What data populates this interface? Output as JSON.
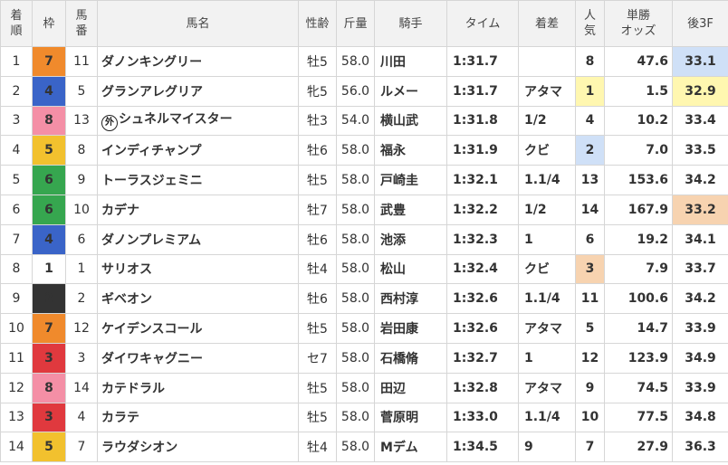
{
  "headers": {
    "rank": [
      "着",
      "順"
    ],
    "waku": "枠",
    "umaban": [
      "馬",
      "番"
    ],
    "horse": "馬名",
    "sex_age": "性齢",
    "weight": "斤量",
    "jockey": "騎手",
    "time": "タイム",
    "margin": "着差",
    "popularity": [
      "人",
      "気"
    ],
    "odds": [
      "単勝",
      "オッズ"
    ],
    "last3f": "後3F"
  },
  "waku_colors": {
    "1": "#ffffff",
    "2": "#333333",
    "3": "#e0393e",
    "4": "#3a64c8",
    "5": "#f2c12e",
    "6": "#36a64f",
    "7": "#f08a2c",
    "8": "#f48fa6"
  },
  "highlight_colors": {
    "pop1": "#fff7b0",
    "pop2": "#cfe0f7",
    "pop3": "#f7d3b0",
    "l3f1": "#cfe0f7",
    "l3f2": "#fff7b0",
    "l3f3": "#f7d3b0"
  },
  "rows": [
    {
      "rank": "1",
      "waku": "7",
      "umaban": "11",
      "horse": "ダノンキングリー",
      "foreign": false,
      "sex_age": "牡5",
      "weight": "58.0",
      "jockey": "川田",
      "time": "1:31.7",
      "margin": "",
      "popularity": "8",
      "odds": "47.6",
      "last3f": "33.1",
      "odds_red": false,
      "pop_hl": "",
      "l3f_hl": "l3f1"
    },
    {
      "rank": "2",
      "waku": "4",
      "umaban": "5",
      "horse": "グランアレグリア",
      "foreign": false,
      "sex_age": "牝5",
      "weight": "56.0",
      "jockey": "ルメー",
      "time": "1:31.7",
      "margin": "アタマ",
      "popularity": "1",
      "odds": "1.5",
      "last3f": "32.9",
      "odds_red": true,
      "pop_hl": "pop1",
      "l3f_hl": "l3f2"
    },
    {
      "rank": "3",
      "waku": "8",
      "umaban": "13",
      "horse": "シュネルマイスター",
      "foreign": true,
      "foreign_mark": "外",
      "sex_age": "牡3",
      "weight": "54.0",
      "jockey": "横山武",
      "time": "1:31.8",
      "margin": "1/2",
      "popularity": "4",
      "odds": "10.2",
      "last3f": "33.4",
      "odds_red": false,
      "pop_hl": "",
      "l3f_hl": ""
    },
    {
      "rank": "4",
      "waku": "5",
      "umaban": "8",
      "horse": "インディチャンプ",
      "foreign": false,
      "sex_age": "牡6",
      "weight": "58.0",
      "jockey": "福永",
      "time": "1:31.9",
      "margin": "クビ",
      "popularity": "2",
      "odds": "7.0",
      "last3f": "33.5",
      "odds_red": true,
      "pop_hl": "pop2",
      "l3f_hl": ""
    },
    {
      "rank": "5",
      "waku": "6",
      "umaban": "9",
      "horse": "トーラスジェミニ",
      "foreign": false,
      "sex_age": "牡5",
      "weight": "58.0",
      "jockey": "戸崎圭",
      "time": "1:32.1",
      "margin": "1.1/4",
      "popularity": "13",
      "odds": "153.6",
      "last3f": "34.2",
      "odds_red": false,
      "pop_hl": "",
      "l3f_hl": ""
    },
    {
      "rank": "6",
      "waku": "6",
      "umaban": "10",
      "horse": "カデナ",
      "foreign": false,
      "sex_age": "牡7",
      "weight": "58.0",
      "jockey": "武豊",
      "time": "1:32.2",
      "margin": "1/2",
      "popularity": "14",
      "odds": "167.9",
      "last3f": "33.2",
      "odds_red": false,
      "pop_hl": "",
      "l3f_hl": "l3f3"
    },
    {
      "rank": "7",
      "waku": "4",
      "umaban": "6",
      "horse": "ダノンプレミアム",
      "foreign": false,
      "sex_age": "牡6",
      "weight": "58.0",
      "jockey": "池添",
      "time": "1:32.3",
      "margin": "1",
      "popularity": "6",
      "odds": "19.2",
      "last3f": "34.1",
      "odds_red": false,
      "pop_hl": "",
      "l3f_hl": ""
    },
    {
      "rank": "8",
      "waku": "1",
      "umaban": "1",
      "horse": "サリオス",
      "foreign": false,
      "sex_age": "牡4",
      "weight": "58.0",
      "jockey": "松山",
      "time": "1:32.4",
      "margin": "クビ",
      "popularity": "3",
      "odds": "7.9",
      "last3f": "33.7",
      "odds_red": true,
      "pop_hl": "pop3",
      "l3f_hl": ""
    },
    {
      "rank": "9",
      "waku": "2",
      "umaban": "2",
      "horse": "ギベオン",
      "foreign": false,
      "sex_age": "牡6",
      "weight": "58.0",
      "jockey": "西村淳",
      "time": "1:32.6",
      "margin": "1.1/4",
      "popularity": "11",
      "odds": "100.6",
      "last3f": "34.2",
      "odds_red": false,
      "pop_hl": "",
      "l3f_hl": ""
    },
    {
      "rank": "10",
      "waku": "7",
      "umaban": "12",
      "horse": "ケイデンスコール",
      "foreign": false,
      "sex_age": "牡5",
      "weight": "58.0",
      "jockey": "岩田康",
      "time": "1:32.6",
      "margin": "アタマ",
      "popularity": "5",
      "odds": "14.7",
      "last3f": "33.9",
      "odds_red": false,
      "pop_hl": "",
      "l3f_hl": ""
    },
    {
      "rank": "11",
      "waku": "3",
      "umaban": "3",
      "horse": "ダイワキャグニー",
      "foreign": false,
      "sex_age": "セ7",
      "weight": "58.0",
      "jockey": "石橋脩",
      "time": "1:32.7",
      "margin": "1",
      "popularity": "12",
      "odds": "123.9",
      "last3f": "34.9",
      "odds_red": false,
      "pop_hl": "",
      "l3f_hl": ""
    },
    {
      "rank": "12",
      "waku": "8",
      "umaban": "14",
      "horse": "カテドラル",
      "foreign": false,
      "sex_age": "牡5",
      "weight": "58.0",
      "jockey": "田辺",
      "time": "1:32.8",
      "margin": "アタマ",
      "popularity": "9",
      "odds": "74.5",
      "last3f": "33.9",
      "odds_red": false,
      "pop_hl": "",
      "l3f_hl": ""
    },
    {
      "rank": "13",
      "waku": "3",
      "umaban": "4",
      "horse": "カラテ",
      "foreign": false,
      "sex_age": "牡5",
      "weight": "58.0",
      "jockey": "菅原明",
      "time": "1:33.0",
      "margin": "1.1/4",
      "popularity": "10",
      "odds": "77.5",
      "last3f": "34.8",
      "odds_red": false,
      "pop_hl": "",
      "l3f_hl": ""
    },
    {
      "rank": "14",
      "waku": "5",
      "umaban": "7",
      "horse": "ラウダシオン",
      "foreign": false,
      "sex_age": "牡4",
      "weight": "58.0",
      "jockey": "Mデム",
      "time": "1:34.5",
      "margin": "9",
      "popularity": "7",
      "odds": "27.9",
      "last3f": "36.3",
      "odds_red": false,
      "pop_hl": "",
      "l3f_hl": ""
    }
  ]
}
